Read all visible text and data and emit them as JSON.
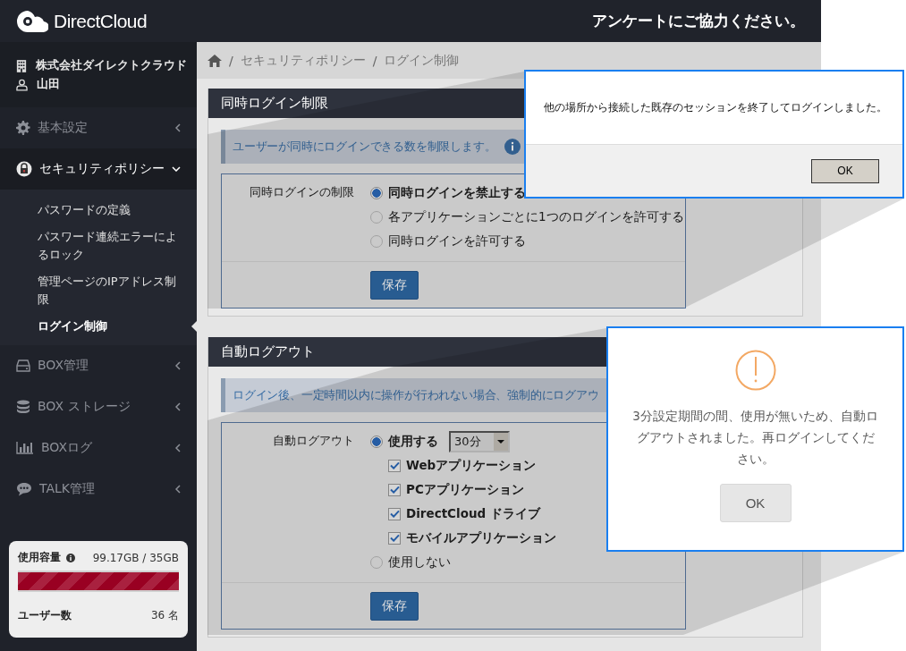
{
  "header": {
    "logo": "DirectCloud",
    "notice": "アンケートにご協力ください。"
  },
  "sidebar": {
    "company": "株式会社ダイレクトクラウド",
    "user": "山田",
    "items": [
      {
        "label": "基本設定",
        "expanded": false
      },
      {
        "label": "セキュリティポリシー",
        "expanded": true,
        "children": [
          {
            "label": "パスワードの定義",
            "selected": false
          },
          {
            "label": "パスワード連続エラーによるロック",
            "selected": false
          },
          {
            "label": "管理ページのIPアドレス制限",
            "selected": false
          },
          {
            "label": "ログイン制御",
            "selected": true
          }
        ]
      },
      {
        "label": "BOX管理",
        "expanded": false
      },
      {
        "label": "BOX ストレージ",
        "expanded": false
      },
      {
        "label": "BOXログ",
        "expanded": false
      },
      {
        "label": "TALK管理",
        "expanded": false
      }
    ]
  },
  "storage": {
    "label": "使用容量",
    "usage": "99.17GB / 35GB",
    "level": 1,
    "users_label": "ユーザー数",
    "users": "36 名"
  },
  "breadcrumb": [
    {
      "separator": "/",
      "label": "セキュリティポリシー"
    },
    {
      "separator": "/",
      "label": "ログイン制御"
    }
  ],
  "panels": [
    {
      "title": "同時ログイン制限",
      "description": "ユーザーが同時にログインできる数を制限します。",
      "info_icon": true,
      "field_label": "同時ログインの制限",
      "options": [
        {
          "kind": "radio",
          "label": "同時ログインを禁止する",
          "selected": true
        },
        {
          "kind": "radio",
          "label": "各アプリケーションごとに1つのログインを許可する",
          "selected": false
        },
        {
          "kind": "radio",
          "label": "同時ログインを許可する",
          "selected": false
        }
      ],
      "save": "保存"
    },
    {
      "title": "自動ログアウト",
      "description": "ログイン後、一定時間以内に操作が行われない場合、強制的にログアウ",
      "field_label": "自動ログアウト",
      "options": [
        {
          "kind": "radio",
          "label": "使用する",
          "selected": true,
          "select": "30分"
        },
        {
          "kind": "checkbox",
          "label": "Webアプリケーション",
          "checked": true
        },
        {
          "kind": "checkbox",
          "label": "PCアプリケーション",
          "checked": true
        },
        {
          "kind": "checkbox",
          "label": "DirectCloud ドライブ",
          "checked": true
        },
        {
          "kind": "checkbox",
          "label": "モバイルアプリケーション",
          "checked": true
        },
        {
          "kind": "radio",
          "label": "使用しない",
          "selected": false
        }
      ],
      "save": "保存"
    }
  ],
  "dialogs": [
    {
      "kind": "plain",
      "message": "他の場所から接続した既存のセッションを終了してログインしました。",
      "button": "OK"
    },
    {
      "kind": "warning",
      "message": "3分設定期間の間、使用が無いため、自動ログアウトされました。再ログインしてください。",
      "button": "OK"
    }
  ]
}
